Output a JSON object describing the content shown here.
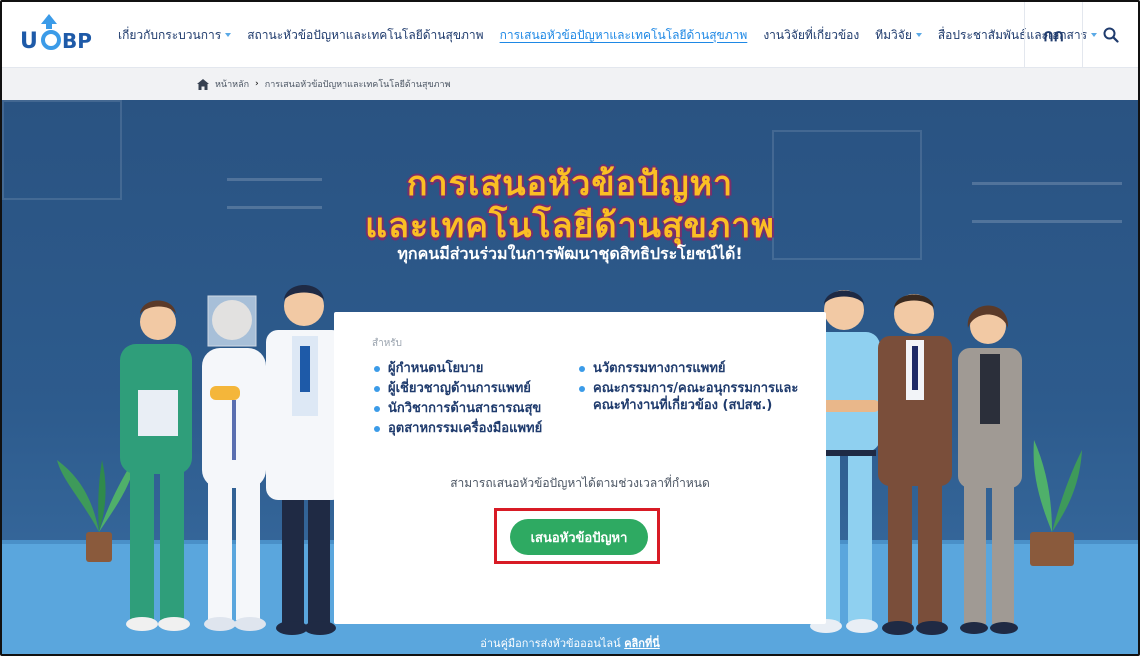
{
  "header": {
    "logo_text": "UCBP",
    "nav": [
      {
        "label": "เกี่ยวกับกระบวนการ",
        "dropdown": true,
        "active": false
      },
      {
        "label": "สถานะหัวข้อปัญหาและเทคโนโลยีด้านสุขภาพ",
        "dropdown": false,
        "active": false
      },
      {
        "label": "การเสนอหัวข้อปัญหาและเทคโนโลยีด้านสุขภาพ",
        "dropdown": false,
        "active": true
      },
      {
        "label": "งานวิจัยที่เกี่ยวข้อง",
        "dropdown": false,
        "active": false
      },
      {
        "label": "ทีมวิจัย",
        "dropdown": true,
        "active": false
      },
      {
        "label": "สื่อประชาสัมพันธ์และเอกสาร",
        "dropdown": true,
        "active": false
      }
    ],
    "lang_label": "กก",
    "search_icon": "search-icon"
  },
  "breadcrumb": {
    "home": "หน้าหลัก",
    "current": "การเสนอหัวข้อปัญหาและเทคโนโลยีด้านสุขภาพ"
  },
  "hero": {
    "title_line1": "การเสนอหัวข้อปัญหา",
    "title_line2": "และเทคโนโลยีด้านสุขภาพ",
    "subtitle": "ทุกคนมีส่วนร่วมในการพัฒนาชุดสิทธิประโยชน์ได้!",
    "colors": {
      "title": "#fbbf24",
      "title_outline": "#7a2e6b",
      "bg": "#2d5b8d",
      "floor": "#5aa6dd"
    }
  },
  "card": {
    "for_label": "สำหรับ",
    "left_items": [
      "ผู้กำหนดนโยบาย",
      "ผู้เชี่ยวชาญด้านการแพทย์",
      "นักวิชาการด้านสาธารณสุข",
      "อุตสาหกรรมเครื่องมือแพทย์"
    ],
    "right_items": [
      "นวัตกรรมทางการแพทย์",
      "คณะกรรมการ/คณะอนุกรรมการและคณะทำงานที่เกี่ยวข้อง (สปสช.)"
    ],
    "note": "สามารถเสนอหัวข้อปัญหาได้ตามช่วงเวลาที่กำหนด",
    "cta_label": "เสนอหัวข้อปัญหา",
    "cta_color": "#2eaa62",
    "highlight_color": "#d81b25"
  },
  "footer_guide": {
    "text": "อ่านคู่มือการส่งหัวข้อออนไลน์",
    "link": "คลิกที่นี่"
  }
}
